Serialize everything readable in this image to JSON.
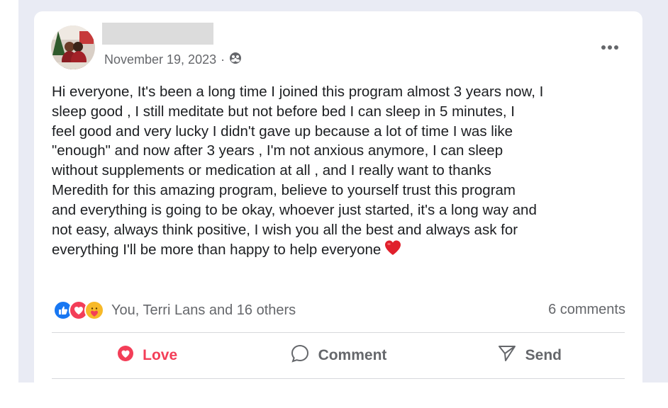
{
  "post": {
    "date": "November 19, 2023",
    "separator": "·",
    "privacy_icon": "group-audience-icon",
    "more_icon": "more-options-icon",
    "body": "Hi everyone, It's been a long time I joined this program almost 3 years now, I\nsleep good , I still meditate but not before bed I can sleep in 5 minutes, I\nfeel good and very lucky I didn't gave up because a lot of time I was like\n\"enough\" and now after 3 years , I'm not anxious anymore, I can sleep\nwithout supplements or medication at all , and I really want to thanks\nMeredith for this amazing program, believe to yourself trust this program\nand everything is going to be okay, whoever just started, it's a long way and\nnot easy, always think positive, I wish you all the best and always ask for\neverything I'll be more than happy to help everyone",
    "body_end_emoji": "red-heart-icon"
  },
  "reactions": {
    "icons": [
      "like-icon",
      "love-icon",
      "care-icon"
    ],
    "summary": "You, Terri Lans and 16 others",
    "comments": "6 comments"
  },
  "actions": {
    "love_label": "Love",
    "comment_label": "Comment",
    "send_label": "Send"
  },
  "colors": {
    "love": "#f33e58",
    "like": "#1877f2",
    "muted": "#65676b",
    "text": "#1c1e21"
  }
}
